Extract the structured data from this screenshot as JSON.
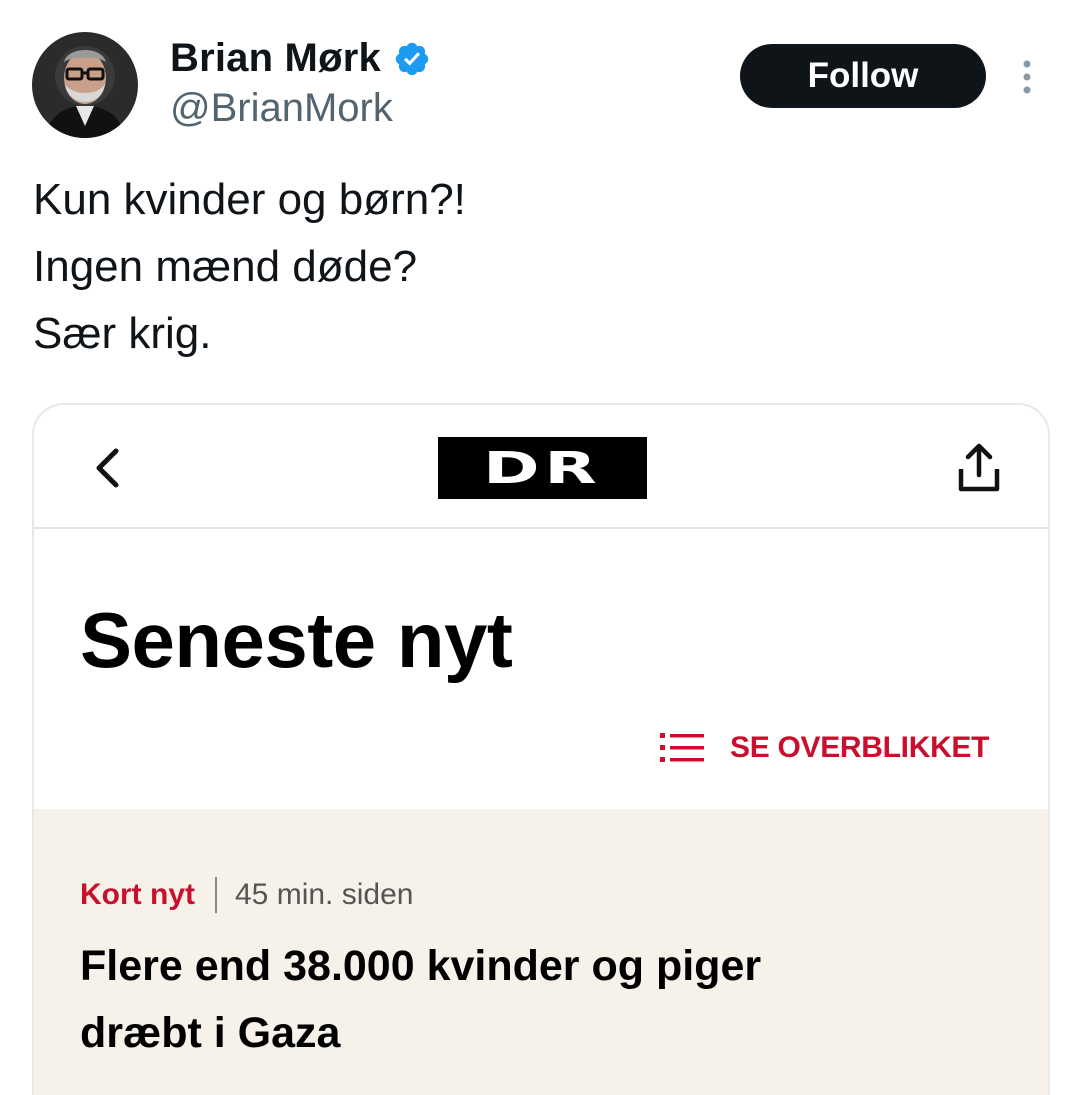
{
  "author": {
    "display_name": "Brian Mørk",
    "handle": "@BrianMork",
    "verified": true
  },
  "actions": {
    "follow_label": "Follow"
  },
  "tweet": {
    "lines": [
      "Kun kvinder og børn?!",
      "Ingen mænd døde?",
      "Sær krig."
    ]
  },
  "media": {
    "logo_text": "DR",
    "section_title": "Seneste nyt",
    "overview_label": "SE OVERBLIKKET",
    "news_item": {
      "tag": "Kort nyt",
      "time": "45 min. siden",
      "headline_lines": [
        "Flere end 38.000 kvinder og piger",
        "dræbt i Gaza"
      ]
    }
  },
  "colors": {
    "text_primary": "#0f1419",
    "text_secondary": "#536471",
    "verified_blue": "#1d9bf0",
    "dr_red": "#c8102e",
    "news_background": "#f6f2ea"
  },
  "icons": {
    "verified": "verified-badge-icon",
    "more": "more-vertical-icon",
    "back": "chevron-left-icon",
    "share": "share-icon",
    "list": "list-icon"
  }
}
